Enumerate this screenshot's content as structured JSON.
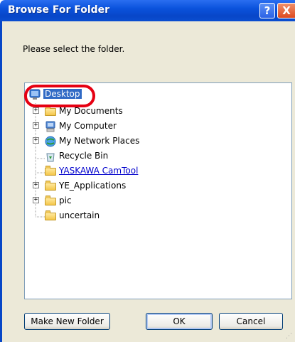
{
  "window": {
    "title": "Browse For Folder",
    "help_glyph": "?",
    "close_glyph": "X"
  },
  "prompt": "Please select the folder.",
  "tree": {
    "items": [
      {
        "label": "Desktop",
        "icon": "desktop-icon",
        "selected": true
      },
      {
        "label": "My Documents",
        "icon": "my-documents-icon",
        "expandable": true
      },
      {
        "label": "My Computer",
        "icon": "my-computer-icon",
        "expandable": true
      },
      {
        "label": "My Network Places",
        "icon": "network-places-icon",
        "expandable": true
      },
      {
        "label": "Recycle Bin",
        "icon": "recycle-bin-icon",
        "expandable": false
      },
      {
        "label": "YASKAWA CamTool",
        "icon": "folder-icon",
        "expandable": false,
        "link": true
      },
      {
        "label": "YE_Applications",
        "icon": "folder-icon",
        "expandable": true
      },
      {
        "label": "pic",
        "icon": "folder-icon",
        "expandable": true
      },
      {
        "label": "uncertain",
        "icon": "folder-icon",
        "expandable": false
      }
    ],
    "expander_glyph": "+"
  },
  "buttons": {
    "make_new_folder": "Make New Folder",
    "ok": "OK",
    "cancel": "Cancel"
  },
  "colors": {
    "selection": "#316ac5",
    "highlight_ring": "#e60012",
    "titlebar": "#0a52dc",
    "dialog_bg": "#ece9d8"
  }
}
